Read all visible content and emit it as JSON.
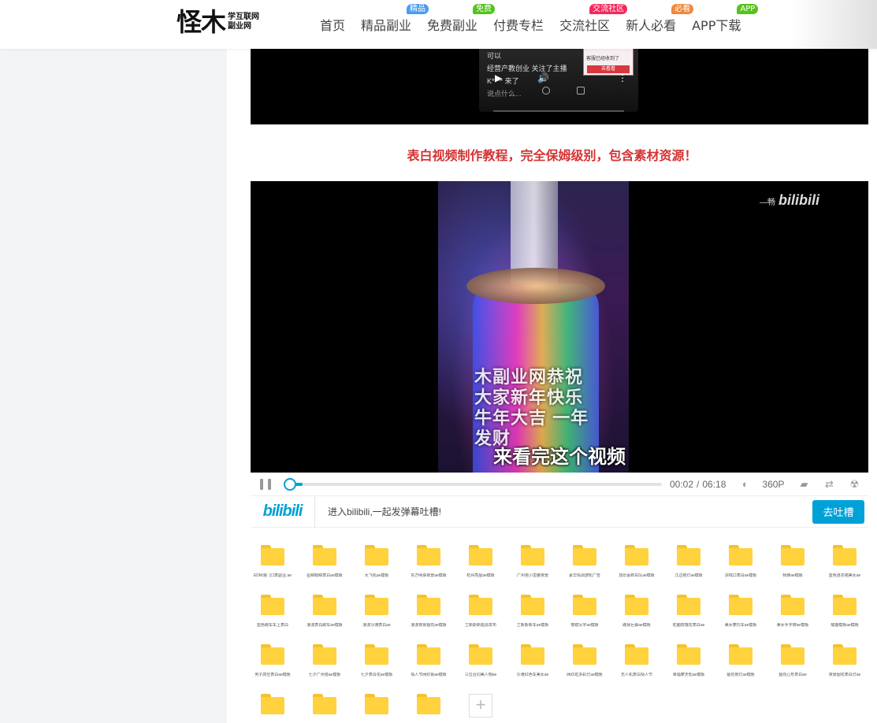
{
  "header": {
    "logo_main": "怪木",
    "logo_sub": "学互联网副业网",
    "nav": [
      {
        "label": "首页"
      },
      {
        "label": "精品副业",
        "badge": "精品",
        "badge_color": "#4a9cf0"
      },
      {
        "label": "免费副业",
        "badge": "免费",
        "badge_color": "#52c41a"
      },
      {
        "label": "付费专栏"
      },
      {
        "label": "交流社区",
        "badge": "交流社区",
        "badge_color": "#f5285a"
      },
      {
        "label": "新人必看",
        "badge": "必看",
        "badge_color": "#f0883a"
      },
      {
        "label": "APP下载",
        "badge": "APP",
        "badge_color": "#52c41a"
      }
    ]
  },
  "video1": {
    "lines": [
      "可以",
      "经营产教创业 关注了主播",
      "K**** 来了",
      "说点什么..."
    ],
    "popup_title": "客服已经收到了",
    "popup_button": "去看看"
  },
  "promo_text": "表白视频制作教程，完全保姆级别，包含素材资源！",
  "video2": {
    "tower_text": "木副业网恭祝大家新年快乐 牛年大吉 一年发财",
    "subtitle": "来看完这个视频",
    "watermark_prefix": "—畅",
    "watermark": "bilibili"
  },
  "player": {
    "progress": 0.005,
    "current_time": "00:02",
    "separator": "/",
    "duration": "06:18",
    "quality": "360P"
  },
  "danmaku": {
    "logo": "bilibili",
    "prompt": "进入bilibili,一起发弹幕吐槽!",
    "button": "去吐槽"
  },
  "files": [
    "EDM浪门口表副业.ae",
    "星眸眼睛表白ae模板",
    "大飞机ae模板",
    "东方明珠夜景ae模板",
    "杭州亮屋ae模板",
    "广州塔小蛮腰夜景",
    "豪华情调游轮广告",
    "加长豪新车队ae模板",
    "江边夜灯ae模板",
    "漂栈口表白ae模板",
    "杨柳ae模板",
    "蓝色连衣裙美女ae",
    "蓝色跑车车上表白",
    "浪漫表白跑车ae模板",
    "浪漫沙滩表白ae",
    "浪漫夜景烟花ae模板",
    "兰新斯新能源发布",
    "兰新斯新车ae模板",
    "慢镜写字ae模板",
    "路易巨幕ae模板",
    "蛇脑玫瑰花表白ae",
    "美女摩托车ae模板",
    "美女手字牌ae模板",
    "橘猫模板ae模板",
    "男子高空表白ae模板",
    "七夕广州塔ae模板",
    "七夕表白花ae模板",
    "情人节网红街ae模板",
    "三位合同美人物ae",
    "沙滩红色车美女ae",
    "网红蛇多彩灯ae模板",
    "无人机表白情人节",
    "幸福摩天轮ae模板",
    "烟花夜灯ae模板",
    "烟花心形表白ae",
    "夜景烟花表白灯ae",
    "",
    "",
    "",
    ""
  ],
  "add_label": "+"
}
